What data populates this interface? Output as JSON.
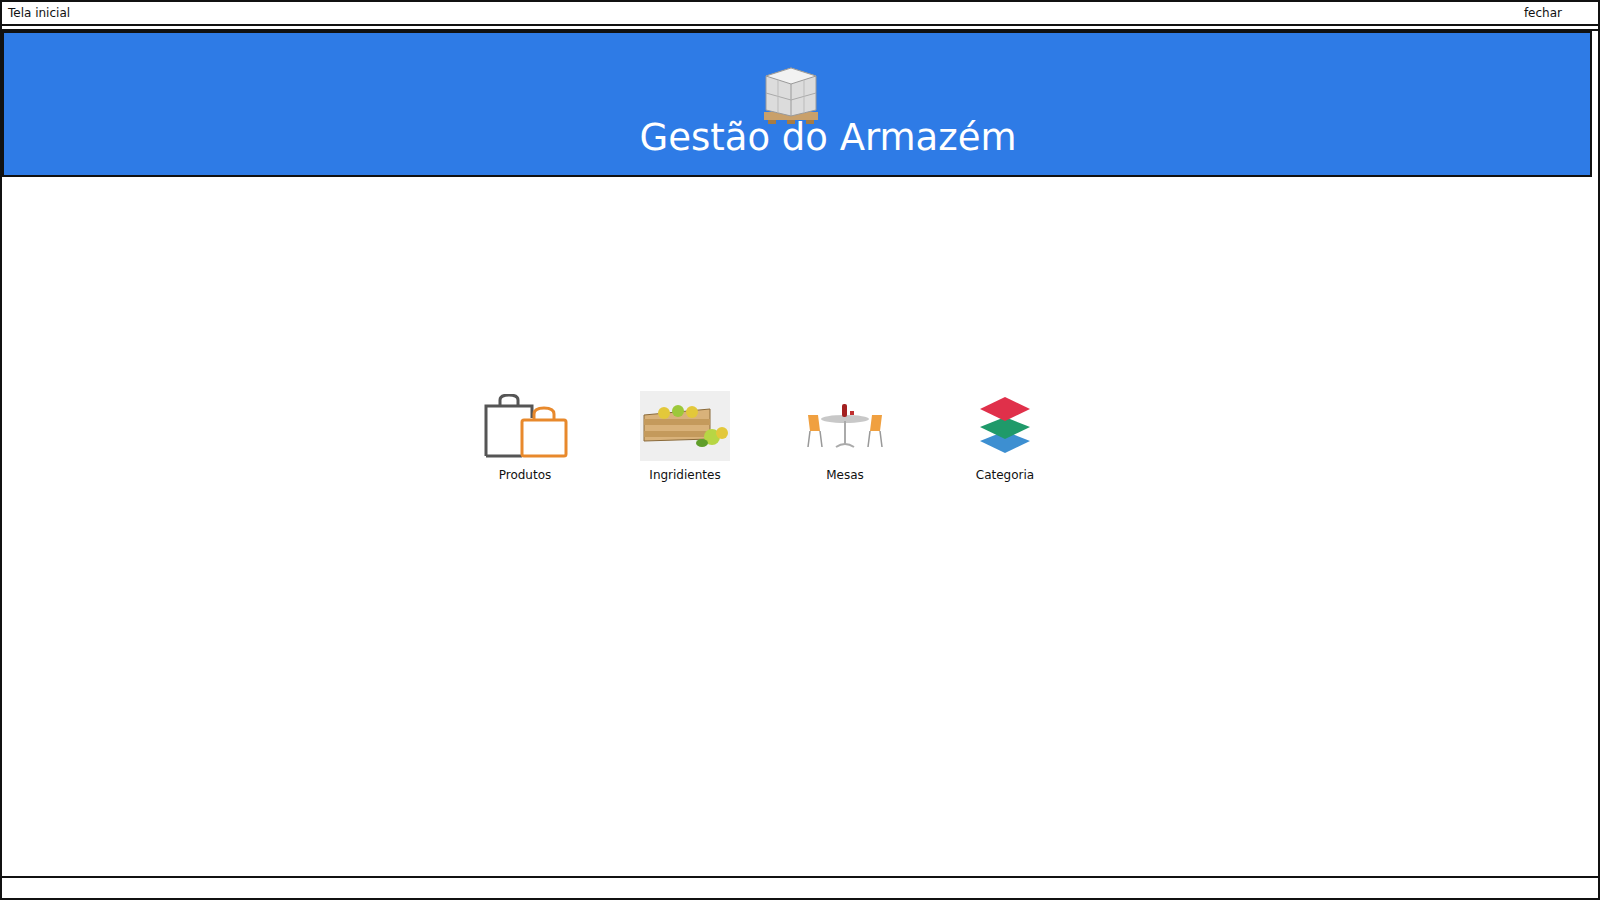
{
  "window": {
    "title": "Tela inicial",
    "close": "fechar"
  },
  "header": {
    "title": "Gestão do Armazém"
  },
  "menu": [
    {
      "label": "Produtos"
    },
    {
      "label": "Ingridientes"
    },
    {
      "label": "Mesas"
    },
    {
      "label": "Categoria"
    }
  ]
}
